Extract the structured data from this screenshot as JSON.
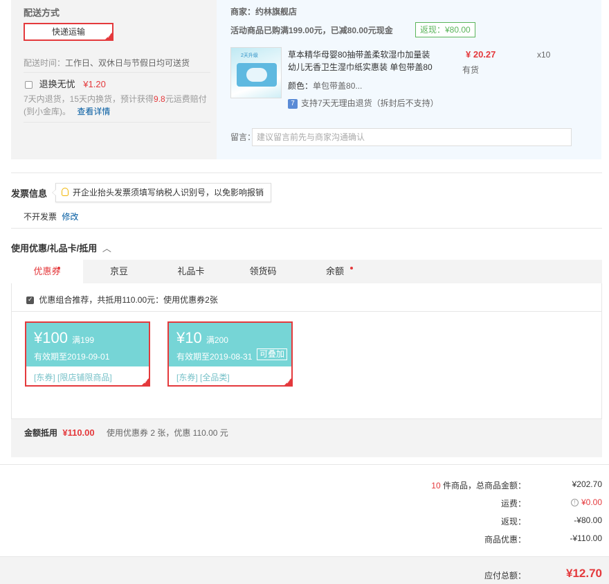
{
  "shipping": {
    "heading": "配送方式",
    "method_label": "快递运输",
    "delivery_time_label": "配送时间：",
    "delivery_time_value": "工作日、双休日与节假日均可送货",
    "insurance_label": "退换无忧",
    "insurance_price": "¥1.20",
    "insurance_desc_1": "7天内退货，15天内换货，预计获得",
    "insurance_desc_amount": "9.8",
    "insurance_desc_2": "元运费赔付",
    "insurance_desc_3": "(到小金库)。",
    "insurance_link": "查看详情"
  },
  "merchant": {
    "label": "商家：约林旗舰店",
    "promo_text": "活动商品已购满199.00元，已减80.00元现金",
    "rebate_badge": "返现：¥80.00",
    "product": {
      "title_line1": "草本精华母婴80抽带盖柔软湿巾加量装",
      "title_line2": "幼儿无香卫生湿巾纸实惠装 单包带盖80",
      "price": "¥ 20.27",
      "quantity": "x10",
      "stock": "有货",
      "color_label": "颜色：",
      "color_value": "单包带盖80...",
      "return_policy": "支持7天无理由退货（拆封后不支持）",
      "return_icon": "7",
      "image_tag": "2天升级"
    },
    "memo_label": "留言：",
    "memo_placeholder": "建议留言前先与商家沟通确认"
  },
  "invoice": {
    "heading": "发票信息",
    "tip": "开企业抬头发票须填写纳税人识别号，以免影响报销",
    "status": "不开发票",
    "edit_link": "修改"
  },
  "discount": {
    "heading": "使用优惠/礼品卡/抵用",
    "tabs": [
      {
        "label": "优惠券"
      },
      {
        "label": "京豆"
      },
      {
        "label": "礼品卡"
      },
      {
        "label": "领货码"
      },
      {
        "label": "余额"
      }
    ],
    "combo_text": "优惠组合推荐，共抵用110.00元：使用优惠券2张",
    "coupons": [
      {
        "amount": "¥100",
        "condition": "满199",
        "expiry": "有效期至2019-09-01",
        "tags": "[东券] [限店铺限商品]",
        "stack": ""
      },
      {
        "amount": "¥10",
        "condition": "满200",
        "expiry": "有效期至2019-08-31",
        "tags": "[东券] [全品类]",
        "stack": "可叠加"
      }
    ],
    "summary_label": "金额抵用",
    "summary_amount": "¥110.00",
    "summary_desc": "使用优惠券 2 张，优惠 110.00 元"
  },
  "totals": {
    "item_count": "10",
    "items_label": " 件商品，总商品金额：",
    "items_value": "¥202.70",
    "freight_label": "运费：",
    "freight_value": "¥0.00",
    "rebate_label": "返现：",
    "rebate_value": "-¥80.00",
    "promo_label": "商品优惠：",
    "promo_value": "-¥110.00",
    "pay_label": "应付总额：",
    "pay_value": "¥12.70"
  },
  "colors": {
    "accent_red": "#e4393c",
    "coupon_teal": "#76d5d6",
    "link_blue": "#005aa0",
    "rebate_green": "#5ab45a"
  }
}
